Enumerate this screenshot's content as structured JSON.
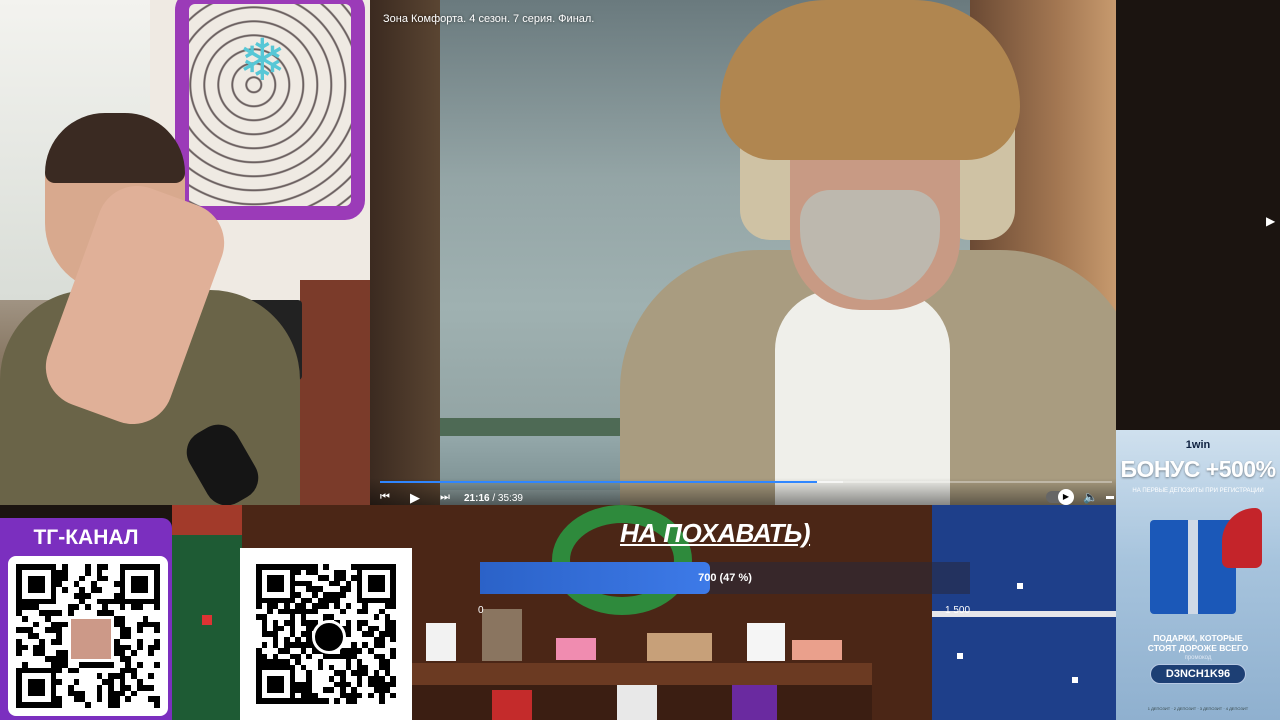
{
  "video": {
    "title": "Зона Комфорта. 4 сезон. 7 серия. Финал.",
    "current_time": "21:16",
    "duration": "35:39",
    "progress": 0.597,
    "buffered": 0.633,
    "controls": {
      "rewind_icon": "skip-back-icon",
      "play_icon": "play-icon",
      "forward_icon": "skip-forward-icon",
      "autoplay_icon": "autoplay-toggle-icon",
      "volume_icon": "volume-icon"
    }
  },
  "donation_goal": {
    "title": "НА ПОХАВАТЬ)",
    "progress_label": "700 (47 %)",
    "current": 700,
    "percent": 47,
    "min_label": "0",
    "max_label": "1 500"
  },
  "telegram": {
    "label": "ТГ-КАНАЛ"
  },
  "ad": {
    "brand": "1win",
    "headline": "БОНУС +500%",
    "subline": "НА ПЕРВЫЕ ДЕПОЗИТЫ ПРИ РЕГИСТРАЦИИ",
    "tagline_1": "ПОДАРКИ, КОТОРЫЕ",
    "tagline_2": "СТОЯТ ДОРОЖЕ ВСЕГО",
    "promo_hint": "промокод",
    "promo_code": "D3NCH1K96",
    "footer": "1 ДЕПОЗИТ · 2 ДЕПОЗИТ · 3 ДЕПОЗИТ · 4 ДЕПОЗИТ"
  },
  "colors": {
    "progress": "#2f86ff",
    "tg_panel": "#7b2fbf",
    "donation_fill": "#3d7ae8",
    "ad_accent": "#1b58b8"
  }
}
